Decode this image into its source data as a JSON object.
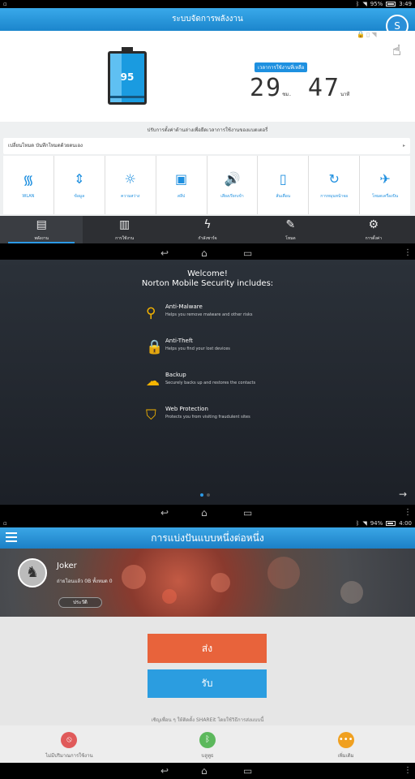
{
  "status_top": {
    "battery": "95%",
    "time": "3:49"
  },
  "status_bottom": {
    "battery": "94%",
    "time": "4:00"
  },
  "power_app": {
    "title": "ระบบจัดการพลังงาน",
    "battery_level": "95",
    "timer_label": "เวลาการใช้งานที่เหลือ",
    "hours": "29",
    "hours_unit": "ชม.",
    "minutes": "47",
    "minutes_unit": "นาที",
    "profile_badge": "S",
    "strip_title": "ปรับการตั้งค่าด้านล่างเพื่อยืดเวลาการใช้งานของแบตเตอรี่",
    "mode_row": "เปลี่ยนโหมด บันทึกโหมดด้วยตนเอง",
    "toggles": [
      {
        "icon": "wifi-icon",
        "glyph": "᯾",
        "label": "WLAN"
      },
      {
        "icon": "sync-icon",
        "glyph": "⇕",
        "label": "ข้อมูล"
      },
      {
        "icon": "brightness-icon",
        "glyph": "☼",
        "label": "ความสว่าง"
      },
      {
        "icon": "sleep-icon",
        "glyph": "▣",
        "label": "สลีป"
      },
      {
        "icon": "sound-icon",
        "glyph": "🔊",
        "label": "เสียงเรียกเข้า"
      },
      {
        "icon": "vibrate-icon",
        "glyph": "▯",
        "label": "สั่นเตือน"
      },
      {
        "icon": "rotate-icon",
        "glyph": "↻",
        "label": "การหมุนหน้าจอ"
      },
      {
        "icon": "airplane-icon",
        "glyph": "✈",
        "label": "โหมดเครื่องบิน"
      }
    ],
    "tabs": [
      {
        "glyph": "▤",
        "label": "พลังงาน",
        "active": true
      },
      {
        "glyph": "▥",
        "label": "การใช้งาน",
        "active": false
      },
      {
        "glyph": "ϟ",
        "label": "กำลังชาร์จ",
        "active": false
      },
      {
        "glyph": "✎",
        "label": "โหมด",
        "active": false
      },
      {
        "glyph": "⚙",
        "label": "การตั้งค่า",
        "active": false
      }
    ]
  },
  "norton": {
    "welcome": "Welcome!",
    "subtitle": "Norton Mobile Security includes:",
    "features": [
      {
        "icon": "magnifier-icon",
        "glyph": "⚲",
        "title": "Anti-Malware",
        "desc": "Helps you remove malware and other risks"
      },
      {
        "icon": "padlock-icon",
        "glyph": "🔒",
        "title": "Anti-Theft",
        "desc": "Helps you find your lost devices"
      },
      {
        "icon": "cloud-upload-icon",
        "glyph": "☁",
        "title": "Backup",
        "desc": "Securely backs up and restores the contacts"
      },
      {
        "icon": "shield-icon",
        "glyph": "⛉",
        "title": "Web Protection",
        "desc": "Protects you from visiting fraudulent sites"
      }
    ]
  },
  "shareit": {
    "title": "การแบ่งปันแบบหนึ่งต่อหนึ่ง",
    "username": "Joker",
    "transfer_stats": "ถ่ายโอนแล้ว 0B ทั้งหมด 0",
    "history_button": "ประวัติ",
    "send_button": "ส่ง",
    "receive_button": "รับ",
    "invite_text": "เชิญเพื่อน ๆ ให้ติดตั้ง SHAREit โดยใช้วิธีการส่งแบบนี้",
    "bottom_tabs": [
      {
        "icon": "no-data-icon",
        "glyph": "⦸",
        "label": "ไม่มีปริมาณการใช้งาน",
        "color": "#e05a5a"
      },
      {
        "icon": "bluetooth-icon",
        "glyph": "ᛒ",
        "label": "บลูทูธ",
        "color": "#5cb85c"
      },
      {
        "icon": "more-icon",
        "glyph": "•••",
        "label": "เพิ่มเติม",
        "color": "#f0a020"
      }
    ]
  }
}
